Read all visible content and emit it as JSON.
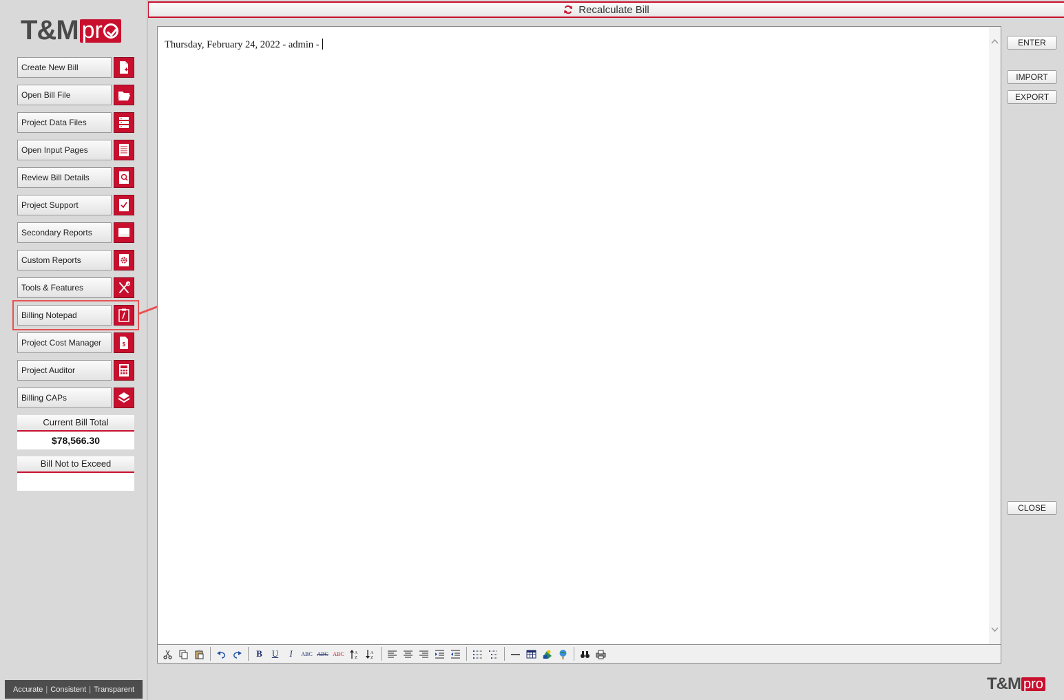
{
  "logo": {
    "tm": "T&M",
    "pro": "pr"
  },
  "logo_footer": {
    "tm": "T&M",
    "pro": "pro"
  },
  "sidebar": {
    "items": [
      {
        "label": "Create New Bill",
        "icon": "new-file-icon"
      },
      {
        "label": "Open Bill File",
        "icon": "folder-open-icon"
      },
      {
        "label": "Project Data Files",
        "icon": "database-icon"
      },
      {
        "label": "Open Input Pages",
        "icon": "document-lines-icon"
      },
      {
        "label": "Review Bill Details",
        "icon": "magnify-document-icon"
      },
      {
        "label": "Project Support",
        "icon": "checklist-icon"
      },
      {
        "label": "Secondary Reports",
        "icon": "report-icon"
      },
      {
        "label": "Custom Reports",
        "icon": "gear-document-icon"
      },
      {
        "label": "Tools & Features",
        "icon": "tools-icon"
      },
      {
        "label": "Billing Notepad",
        "icon": "notepad-icon"
      },
      {
        "label": "Project Cost Manager",
        "icon": "dollar-document-icon"
      },
      {
        "label": "Project Auditor",
        "icon": "calculator-icon"
      },
      {
        "label": "Billing CAPs",
        "icon": "layers-icon"
      }
    ],
    "current_bill_total": {
      "label": "Current Bill Total",
      "value": "$78,566.30"
    },
    "bill_not_to_exceed": {
      "label": "Bill Not to Exceed",
      "value": ""
    },
    "tagline": {
      "a": "Accurate",
      "b": "Consistent",
      "c": "Transparent",
      "sep": "|"
    }
  },
  "header": {
    "title": "Recalculate Bill",
    "icon": "refresh-icon"
  },
  "editor": {
    "content": "Thursday, February 24, 2022 - admin -"
  },
  "toolbar": {
    "groups": [
      [
        "cut-icon",
        "copy-icon",
        "paste-icon"
      ],
      [
        "undo-icon",
        "redo-icon"
      ],
      [
        "bold-icon",
        "underline-icon",
        "italic-icon",
        "spellcheck-icon",
        "strikethrough-icon",
        "spellcheck-red-icon",
        "sort-ascending-icon",
        "sort-descending-icon"
      ],
      [
        "align-left-icon",
        "align-center-icon",
        "align-right-icon",
        "indent-icon",
        "outdent-icon"
      ],
      [
        "bullet-list-icon",
        "numbered-list-icon"
      ],
      [
        "horizontal-rule-icon",
        "table-icon",
        "image-icon",
        "hyperlink-icon"
      ],
      [
        "find-icon",
        "print-icon"
      ]
    ],
    "glyphs": {
      "bold-icon": "B",
      "underline-icon": "U",
      "italic-icon": "I",
      "spellcheck-icon": "ABC",
      "strikethrough-icon": "ABC",
      "spellcheck-red-icon": "ABC"
    }
  },
  "right_buttons": {
    "enter": "ENTER",
    "import": "IMPORT",
    "export": "EXPORT",
    "close": "CLOSE"
  },
  "colors": {
    "brand_red": "#c8102e",
    "annotation_red": "#e85252",
    "sidebar_bg": "#d9d9d9"
  }
}
